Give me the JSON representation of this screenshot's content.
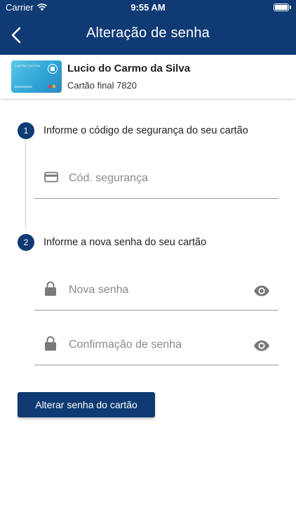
{
  "status_bar": {
    "carrier": "Carrier",
    "time": "9:55 AM"
  },
  "nav": {
    "title": "Alteração de senha",
    "back_icon": "chevron-left-icon"
  },
  "card": {
    "holder_name": "Lucio do Carmo da Silva",
    "number_label": "Cartão final 7820",
    "thumb_text": "CARTÃO DIGITAL"
  },
  "steps": [
    {
      "number": "1",
      "label": "Informe o código de segurança do seu cartão"
    },
    {
      "number": "2",
      "label": "Informe a nova senha do seu cartão"
    }
  ],
  "fields": {
    "security_code": {
      "placeholder": "Cód. segurança",
      "icon": "credit-card-icon"
    },
    "new_password": {
      "placeholder": "Nova senha",
      "icon": "lock-icon",
      "toggle_icon": "eye-icon"
    },
    "confirm_password": {
      "placeholder": "Confirmação de senha",
      "icon": "lock-icon",
      "toggle_icon": "eye-icon"
    }
  },
  "submit_label": "Alterar senha do cartão",
  "colors": {
    "primary": "#0f3a73",
    "placeholder": "#8a8a8a",
    "divider": "#9a9a9a"
  }
}
